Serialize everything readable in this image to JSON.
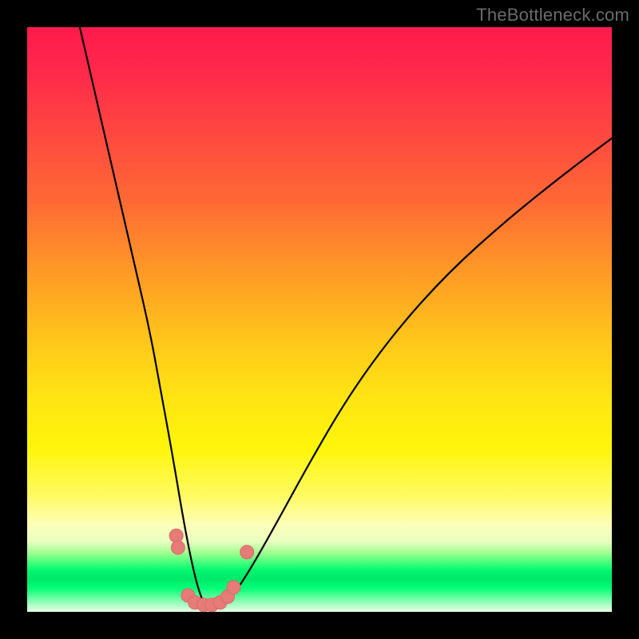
{
  "watermark": "TheBottleneck.com",
  "colors": {
    "frame": "#000000",
    "curve": "#000000",
    "marker_fill": "#e77b78",
    "marker_stroke": "#d86a66",
    "gradient_stops": [
      "#ff1a4d",
      "#ff6a35",
      "#ffe612",
      "#fdffb8",
      "#00f56e",
      "#e8ffe8"
    ]
  },
  "chart_data": {
    "type": "line",
    "title": "",
    "xlabel": "",
    "ylabel": "",
    "xlim": [
      0,
      100
    ],
    "ylim": [
      0,
      100
    ],
    "grid": false,
    "legend": false,
    "series": [
      {
        "name": "curve",
        "x": [
          9,
          12,
          15,
          18,
          21,
          23,
          25,
          26.5,
          28,
          29.5,
          31,
          32.5,
          35,
          38,
          42,
          48,
          55,
          63,
          72,
          82,
          92,
          100
        ],
        "y": [
          100,
          87,
          74,
          61,
          48,
          37,
          26,
          17,
          9,
          3,
          0,
          0.5,
          2.5,
          7,
          14,
          25,
          37,
          48,
          58,
          67,
          75,
          81
        ]
      }
    ],
    "markers": {
      "name": "highlight-points",
      "color": "#e77b78",
      "points": [
        {
          "x": 25.5,
          "y": 13
        },
        {
          "x": 25.8,
          "y": 11
        },
        {
          "x": 27.5,
          "y": 2.8
        },
        {
          "x": 28.7,
          "y": 1.6
        },
        {
          "x": 30.2,
          "y": 1.2
        },
        {
          "x": 31.6,
          "y": 1.2
        },
        {
          "x": 33.0,
          "y": 1.6
        },
        {
          "x": 34.3,
          "y": 2.6
        },
        {
          "x": 35.3,
          "y": 4.2
        },
        {
          "x": 37.6,
          "y": 10.2
        }
      ]
    }
  }
}
